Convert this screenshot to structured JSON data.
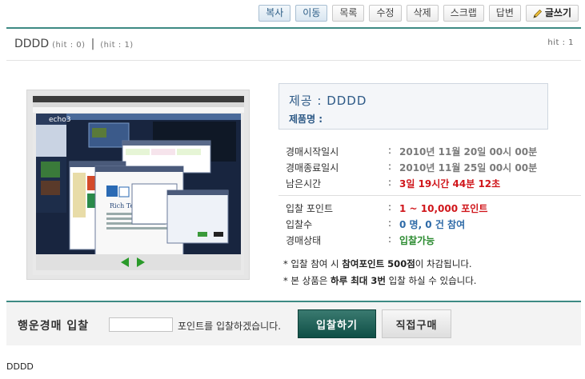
{
  "toolbar": {
    "copy": "복사",
    "move": "이동",
    "list": "목록",
    "edit": "수정",
    "delete": "삭제",
    "scrap": "스크랩",
    "reply": "답변",
    "write": "글쓰기"
  },
  "post": {
    "title": "DDDD",
    "hit_left": "(hit : 0)",
    "hit_mid": "(hit : 1)",
    "separator": "|",
    "hit_right": "hit : 1",
    "body": "DDDD"
  },
  "product": {
    "provider": "제공 : DDDD",
    "name_label": "제품명 :"
  },
  "auction": {
    "start_label": "경매시작일시",
    "start_value": "2010년 11월 20일 00시 00분",
    "end_label": "경매종료일시",
    "end_value": "2010년 11월 25일 00시 00분",
    "remain_label": "남은시간",
    "remain_value": "3일 19시간 44분 12초",
    "point_label": "입찰 포인트",
    "point_value": "1 ~ 10,000 포인트",
    "count_label": "입찰수",
    "count_value": "0 명, 0 건 참여",
    "status_label": "경매상태",
    "status_value": "입찰가능",
    "colon": ":"
  },
  "notes": {
    "n1_pre": "* 입찰 참여 시 ",
    "n1_bold": "참여포인트 500점",
    "n1_post": "이 차감됩니다.",
    "n2_pre": "* 본 상품은 ",
    "n2_bold": "하루 최대 3번",
    "n2_post": " 입찰 하실 수 있습니다."
  },
  "bid": {
    "label": "행운경매 입찰",
    "input_value": "",
    "suffix": "포인트를 입찰하겠습니다.",
    "bid_button": "입찰하기",
    "buy_button": "직접구매"
  },
  "colors": {
    "accent": "#3d8a84",
    "red": "#d0161b",
    "blue": "#2e6aa7",
    "green": "#2a8a2f"
  }
}
